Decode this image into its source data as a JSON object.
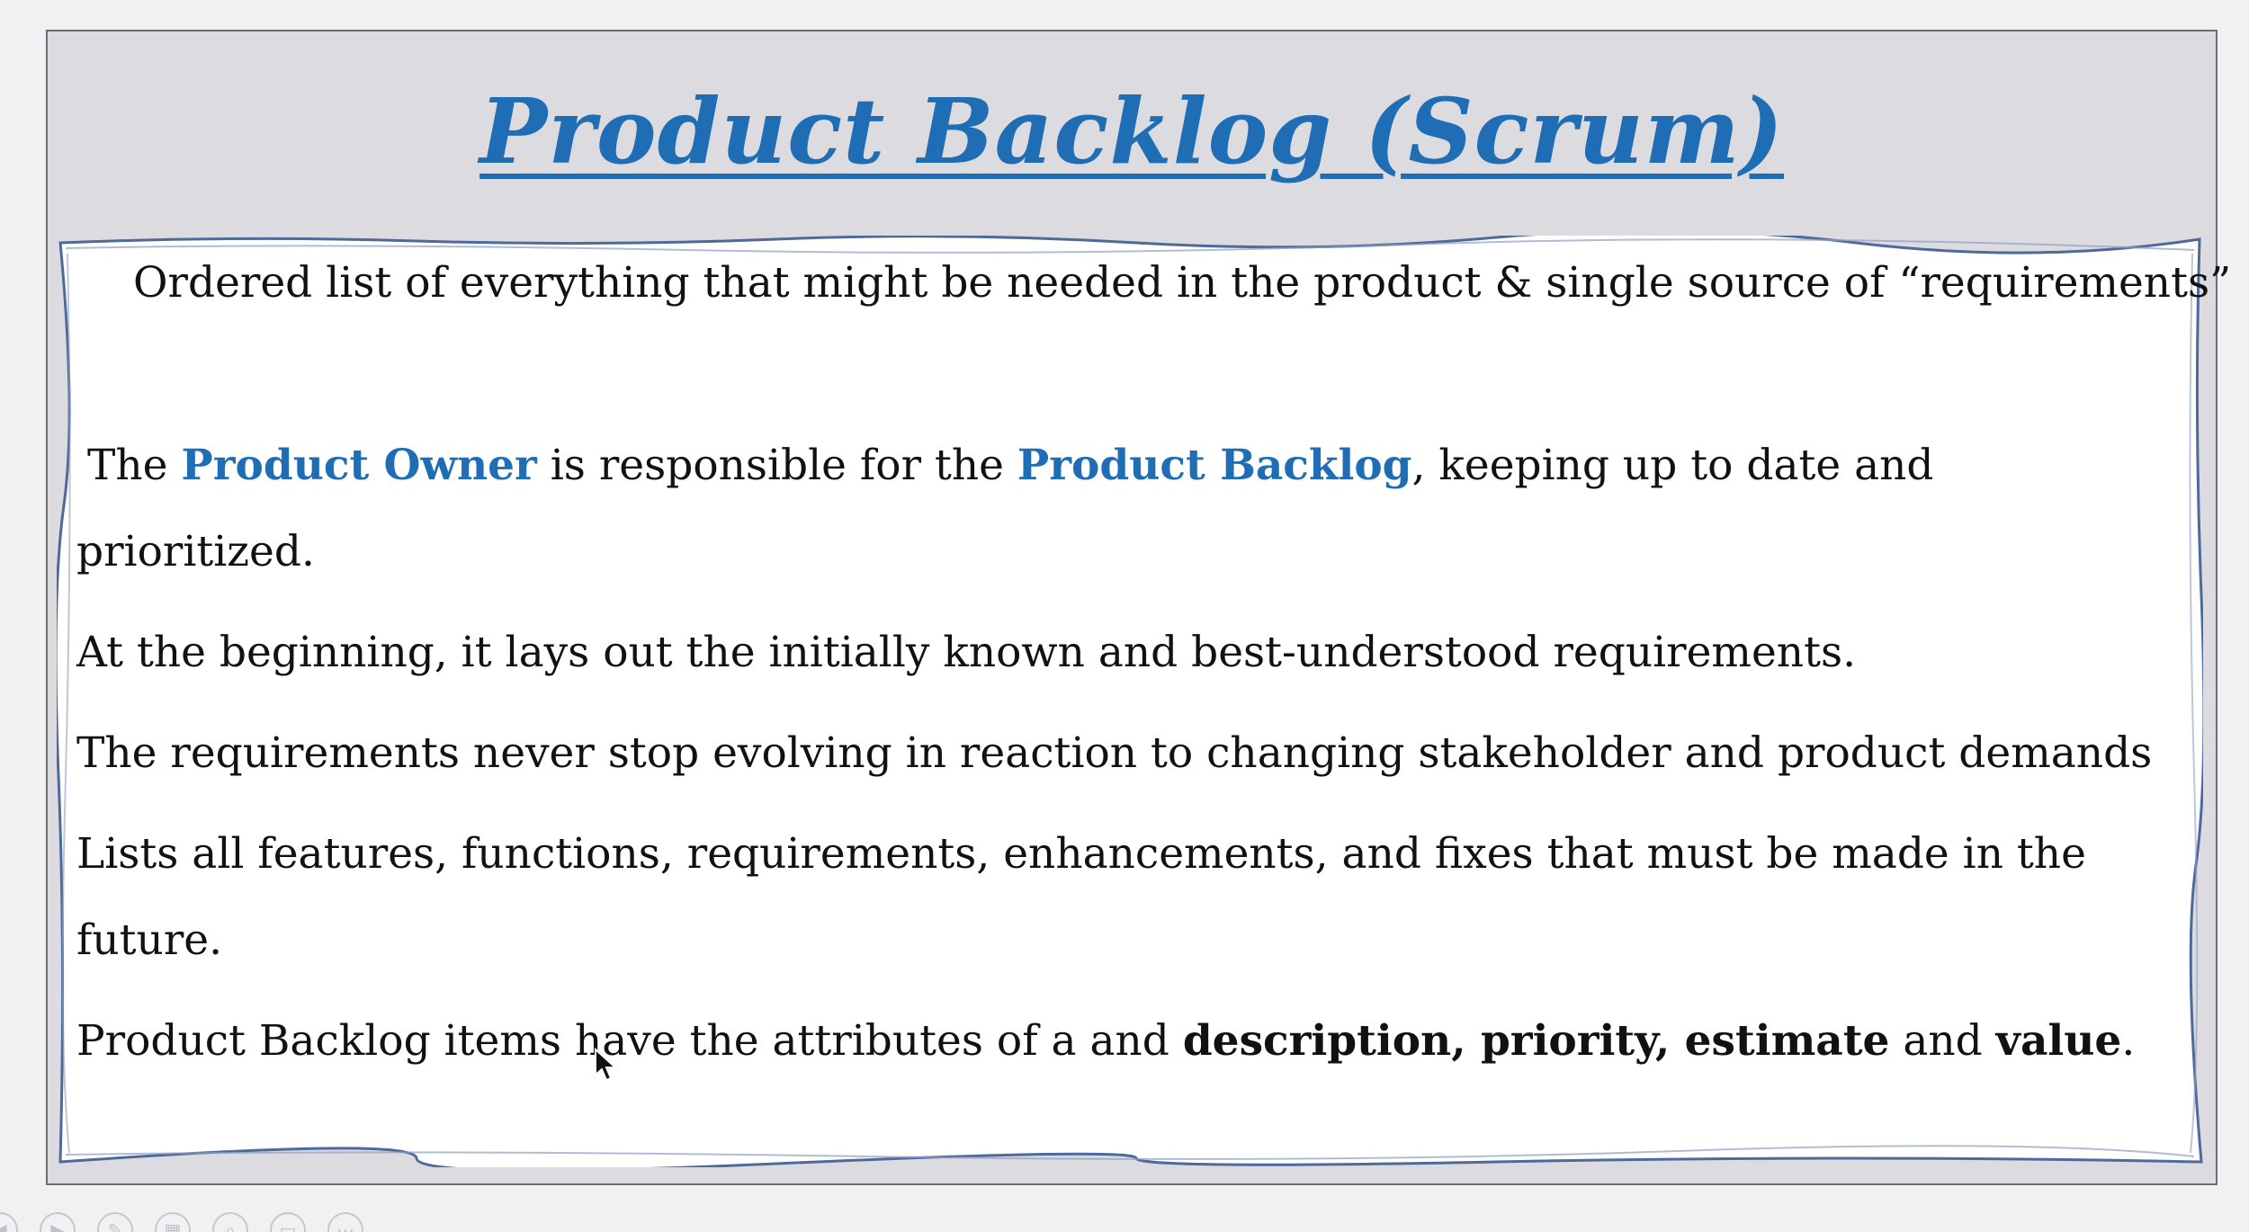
{
  "slide": {
    "title": "Product Backlog (Scrum)",
    "line1": "Ordered list of everything that might be needed in the product & single source of “requirements”",
    "line2": {
      "the": "The ",
      "product_owner": "Product Owner",
      "mid": " is responsible for the ",
      "product_backlog": "Product Backlog",
      "end": ", keeping up to date and"
    },
    "line3": "prioritized.",
    "line4": "At the beginning, it lays out the initially known and best-understood requirements.",
    "line5": "The requirements never stop evolving in reaction to changing stakeholder and product demands",
    "line6": "Lists all features, functions, requirements, enhancements, and fixes that must be made in the",
    "line7": "future.",
    "line8": {
      "start": "Product Backlog items have the attributes of a and ",
      "description": "description, priority, estimate",
      "and": " and ",
      "value": "value",
      "end": "."
    }
  },
  "colors": {
    "title_blue": "#1f6db4",
    "slide_background": "#dcdbe0",
    "content_border": "#4d6a9a"
  },
  "toolbar": {
    "icons": [
      "previous-icon",
      "play-icon",
      "pen-icon",
      "slides-icon",
      "zoom-icon",
      "subtitles-icon",
      "more-icon"
    ],
    "more_label": "⋯"
  }
}
